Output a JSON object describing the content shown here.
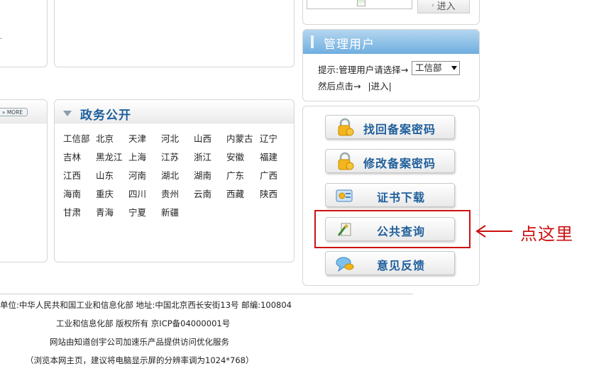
{
  "login": {
    "enter_label": "进入"
  },
  "manage": {
    "title": "管理用户",
    "hint": "提示:管理用户请选择→",
    "dept_selected": "工信部",
    "then": "然后点击→",
    "enter_link": "|进入|"
  },
  "more_label": "» MORE",
  "gov": {
    "title": "政务公开",
    "provinces": [
      "工信部",
      "北京",
      "天津",
      "河北",
      "山西",
      "内蒙古",
      "辽宁",
      "吉林",
      "黑龙江",
      "上海",
      "江苏",
      "浙江",
      "安徽",
      "福建",
      "江西",
      "山东",
      "河南",
      "湖北",
      "湖南",
      "广东",
      "广西",
      "海南",
      "重庆",
      "四川",
      "贵州",
      "云南",
      "西藏",
      "陕西",
      "甘肃",
      "青海",
      "宁夏",
      "新疆"
    ]
  },
  "functions": [
    {
      "label": "找回备案密码",
      "icon": "lock-icon"
    },
    {
      "label": "修改备案密码",
      "icon": "lock-icon"
    },
    {
      "label": "证书下载",
      "icon": "certificate-icon"
    },
    {
      "label": "公共查询",
      "icon": "query-icon"
    },
    {
      "label": "意见反馈",
      "icon": "feedback-icon"
    }
  ],
  "annotation": {
    "text": "点这里",
    "color": "#cc1111"
  },
  "footer": {
    "line1": "单位:中华人民共和国工业和信息化部 地址:中国北京西长安街13号 邮编:100804",
    "line2": "工业和信息化部 版权所有 京ICP备04000001号",
    "line3": "网站由知道创宇公司加速乐产品提供访问优化服务",
    "line4": "（浏览本网主页，建议将电脑显示屏的分辨率调为1024*768）"
  },
  "colors": {
    "accent": "#1f5f9c",
    "header_blue": "#6faee0",
    "annotation": "#cc1111"
  }
}
